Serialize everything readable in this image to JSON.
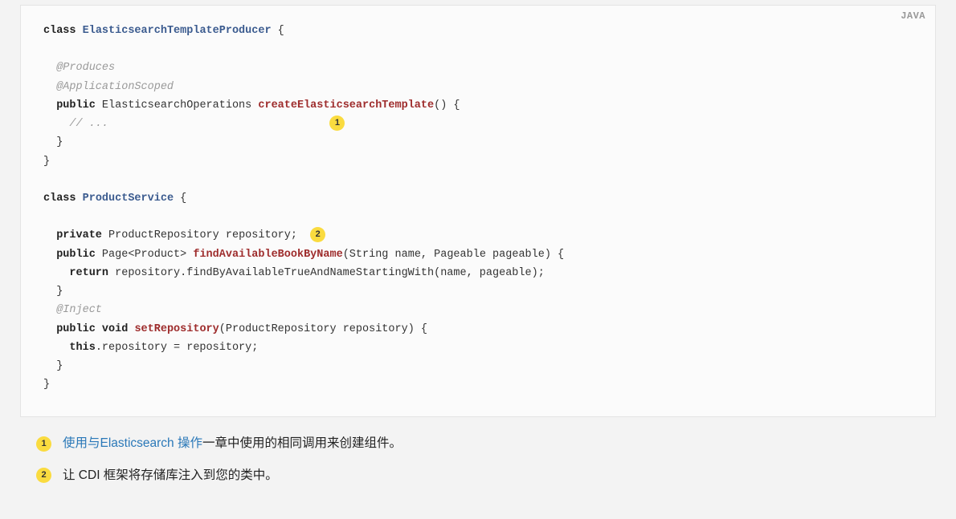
{
  "lang_badge": "JAVA",
  "code": {
    "class1": "ElasticsearchTemplateProducer",
    "ann_produces": "@Produces",
    "ann_appscoped": "@ApplicationScoped",
    "kw_class": "class",
    "kw_public": "public",
    "kw_private": "private",
    "kw_void": "void",
    "kw_return": "return",
    "kw_this": "this",
    "ret_type1": "ElasticsearchOperations",
    "method1": "createElasticsearchTemplate",
    "comment": "// ...",
    "class2": "ProductService",
    "field_type": "ProductRepository",
    "field_name": "repository",
    "ret_type2": "Page<Product>",
    "method2": "findAvailableBookByName",
    "params2": "(String name, Pageable pageable)",
    "retline": "repository.findByAvailableTrueAndNameStartingWith(name, pageable);",
    "ann_inject": "@Inject",
    "method3": "setRepository",
    "params3": "(ProductRepository repository)",
    "setline": ".repository = repository;"
  },
  "callouts": [
    {
      "num": "1",
      "link": "使用与Elasticsearch 操作",
      "rest": "一章中使用的相同调用来创建组件。"
    },
    {
      "num": "2",
      "text": "让 CDI 框架将存储库注入到您的类中。"
    }
  ]
}
